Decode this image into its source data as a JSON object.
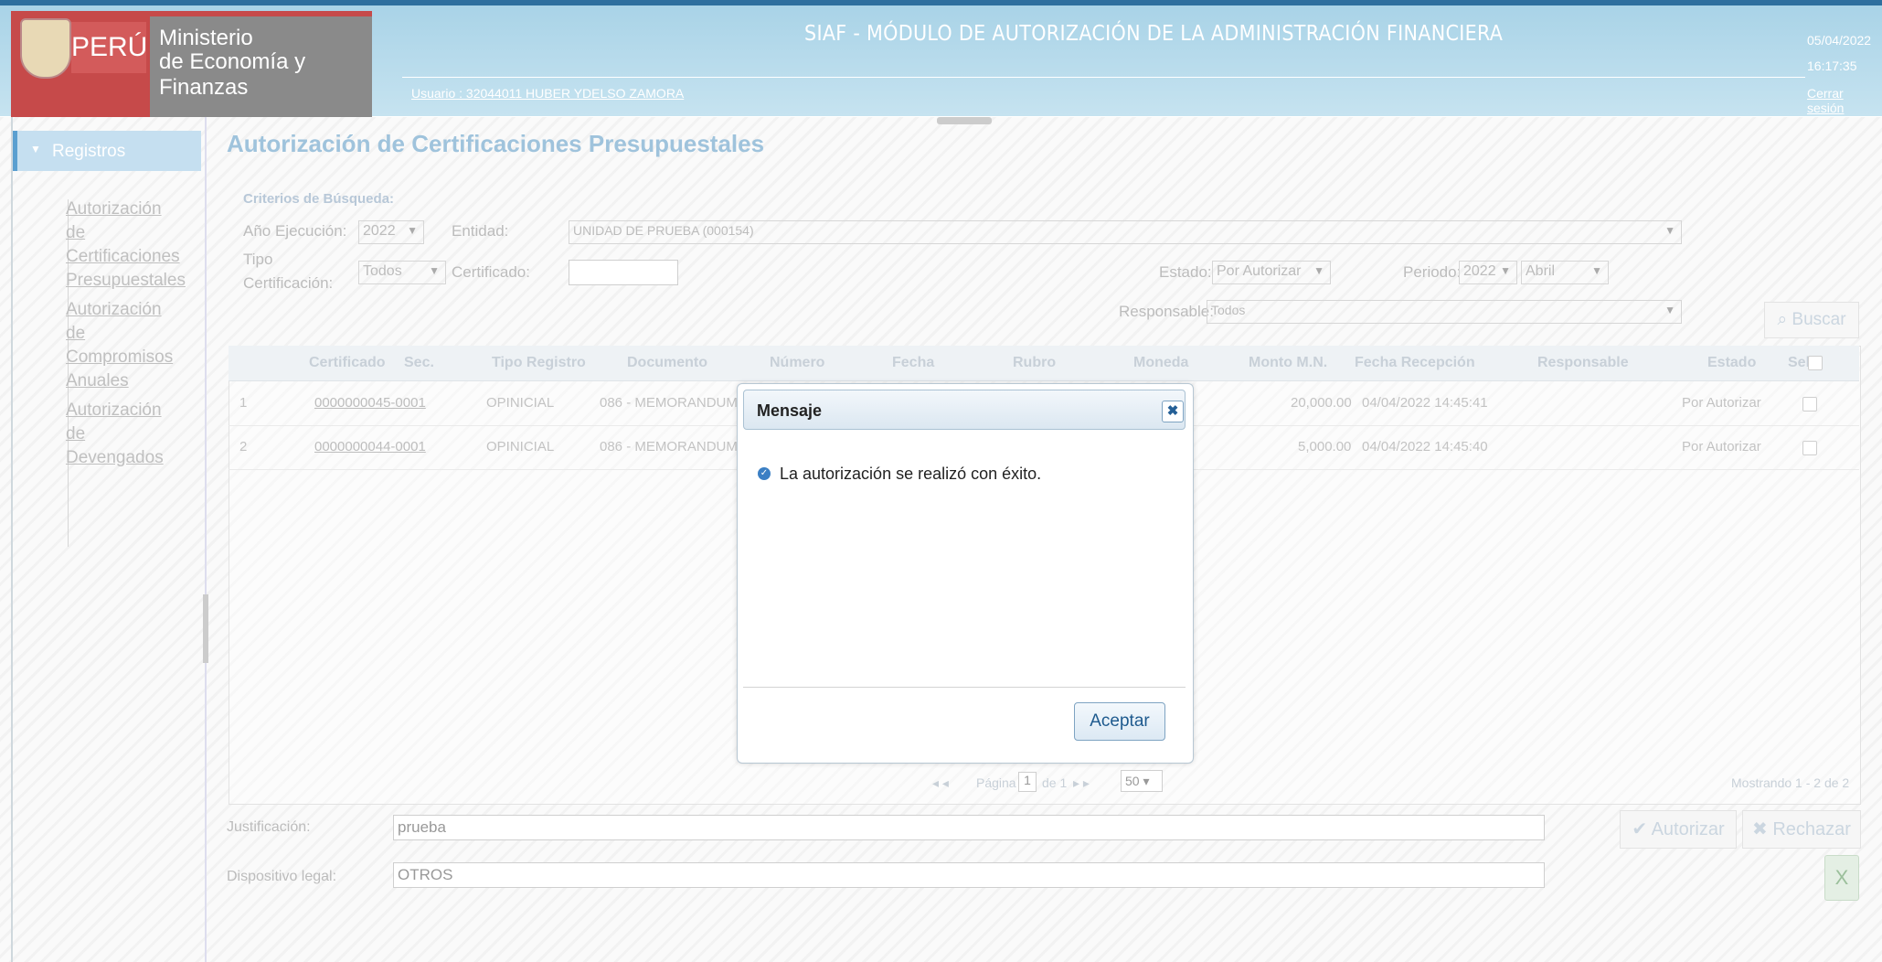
{
  "header": {
    "logo_country": "PERÚ",
    "logo_line1": "Ministerio",
    "logo_line2": "de Economía y Finanzas",
    "title": "SIAF - MÓDULO DE AUTORIZACIÓN DE LA ADMINISTRACIÓN FINANCIERA",
    "user": "Usuario : 32044011 HUBER YDELSO ZAMORA",
    "date": "05/04/2022",
    "time": "16:17:35",
    "logout": "Cerrar sesión"
  },
  "sidebar": {
    "title": "Registros",
    "items": [
      {
        "lines": [
          "Autorización",
          "de",
          "Certificaciones",
          "Presupuestales"
        ]
      },
      {
        "lines": [
          "Autorización",
          "de",
          "Compromisos",
          "Anuales"
        ]
      },
      {
        "lines": [
          "Autorización",
          "de",
          "Devengados"
        ]
      }
    ]
  },
  "main": {
    "title": "Autorización de Certificaciones Presupuestales",
    "criteria_title": "Criterios de Búsqueda:",
    "filters": {
      "anio_label": "Año Ejecución:",
      "anio_value": "2022",
      "entidad_label": "Entidad:",
      "entidad_value": "UNIDAD DE PRUEBA (000154)",
      "tipo_label_1": "Tipo",
      "tipo_label_2": "Certificación:",
      "tipo_value": "Todos",
      "certificado_label": "Certificado:",
      "estado_label": "Estado:",
      "estado_value": "Por Autorizar",
      "periodo_label": "Periodo:",
      "periodo_year": "2022",
      "periodo_month": "Abril",
      "responsable_label": "Responsable:",
      "responsable_value": "Todos"
    },
    "buscar_label": "Buscar",
    "table": {
      "columns": [
        "Certificado",
        "Sec.",
        "Tipo Registro",
        "Documento",
        "Número",
        "Fecha",
        "Rubro",
        "Moneda",
        "Monto M.N.",
        "Fecha Recepción",
        "Responsable",
        "Estado",
        "Sel"
      ],
      "rows": [
        {
          "n": "1",
          "certificado": "0000000045-0001",
          "tipo": "OPINICIAL",
          "documento": "086 - MEMORANDUM",
          "monto": "20,000.00",
          "fecha_recepcion": "04/04/2022 14:45:41",
          "estado": "Por Autorizar"
        },
        {
          "n": "2",
          "certificado": "0000000044-0001",
          "tipo": "OPINICIAL",
          "documento": "086 - MEMORANDUM",
          "monto": "5,000.00",
          "fecha_recepcion": "04/04/2022 14:45:40",
          "estado": "Por Autorizar"
        }
      ]
    },
    "pager": {
      "page_label": "Página",
      "page_value": "1",
      "of_label": "de 1",
      "page_size": "50",
      "showing": "Mostrando 1 - 2 de 2"
    },
    "justificacion_label": "Justificación:",
    "justificacion_value": "prueba",
    "dispositivo_label": "Dispositivo legal:",
    "dispositivo_value": "OTROS",
    "autorizar_label": "Autorizar",
    "rechazar_label": "Rechazar"
  },
  "dialog": {
    "title": "Mensaje",
    "message": "La autorización se realizó con éxito.",
    "ok_label": "Aceptar"
  }
}
